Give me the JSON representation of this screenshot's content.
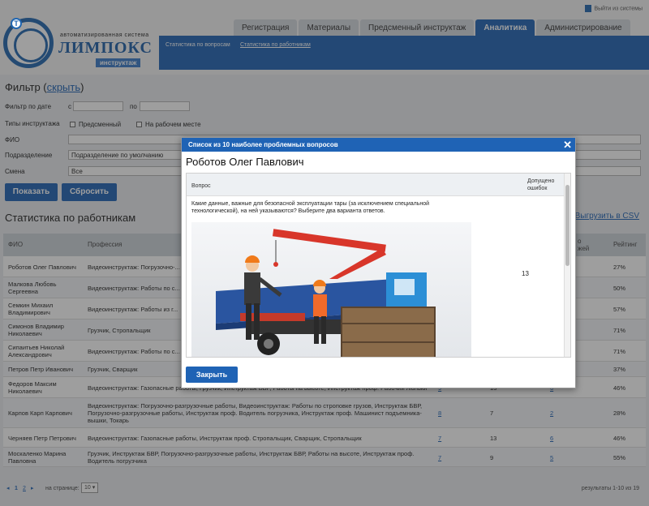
{
  "header": {
    "logo_subtitle": "автоматизированная система",
    "logo_name": "ЛИМПОКС",
    "logo_badge": "инструктаж",
    "logout": "Выйти из системы",
    "tabs": [
      "Регистрация",
      "Материалы",
      "Предсменный инструктаж",
      "Аналитика",
      "Администрирование"
    ],
    "active_tab": "Аналитика",
    "subnav": [
      "Статистика по вопросам",
      "Статистика по работникам"
    ]
  },
  "filter": {
    "title": "Фильтр (",
    "toggle": "скрыть",
    "title_end": ")",
    "date_label": "Фильтр по дате",
    "date_from": "с",
    "date_to": "по",
    "types_label": "Типы инструктажа",
    "type1": "Предсменный",
    "type2": "На рабочем месте",
    "fio_label": "ФИО",
    "dept_label": "Подразделение",
    "dept_value": "Подразделение по умолчанию",
    "shift_label": "Смена",
    "shift_value": "Все",
    "show_button": "Показать",
    "reset_button": "Сбросить"
  },
  "stats": {
    "title": "Статистика по работникам",
    "export": "Выгрузить в CSV",
    "col_fio": "ФИО",
    "col_prof": "Профессия",
    "col_errors_tail": "о",
    "col_errors_tail2": "жей",
    "col_rating": "Рейтинг",
    "rows": [
      {
        "fio": "Роботов Олег Павлович",
        "prof": "Видеоинструктаж: Погрузочно-... электропередачи, Инструктаж...",
        "a": "",
        "b": "",
        "c": "",
        "rating": "27%"
      },
      {
        "fio": "Малкова Любовь Сергеевна",
        "prof": "Видеоинструктаж: Работы по с... Стропальщик, Сварщик, Строп...",
        "a": "",
        "b": "",
        "c": "",
        "rating": "50%"
      },
      {
        "fio": "Семкин Михаил Владимирович",
        "prof": "Видеоинструктаж: Работы из г...",
        "a": "",
        "b": "",
        "c": "",
        "rating": "57%"
      },
      {
        "fio": "Симонов Владимир Николаевич",
        "prof": "Грузчик, Стропальщик",
        "a": "",
        "b": "",
        "c": "",
        "rating": "71%"
      },
      {
        "fio": "Сипаитьев Николай Александрович",
        "prof": "Видеоинструктаж: Работы по с... проф. Стропальщик, Грузчик",
        "a": "",
        "b": "",
        "c": "",
        "rating": "71%"
      },
      {
        "fio": "Петров Петр Иванович",
        "prof": "Грузчик, Сварщик",
        "a": "",
        "b": "",
        "c": "",
        "rating": "37%"
      },
      {
        "fio": "Федоров Максим Николаевич",
        "prof": "Видеоинструктаж: Газопасные работы, Грузчик, Инструктаж БВР, Работы на высоте, Инструктаж проф. Рабочий люльки",
        "a": "9",
        "b": "13",
        "c": "6",
        "rating": "46%"
      },
      {
        "fio": "Карпов Карп Карпович",
        "prof": "Видеоинструктаж: Погрузочно-разгрузочные работы, Видеоинструктаж: Работы по строповке грузов, Инструктаж БВР, Погрузочно-разгрузочные работы, Инструктаж проф. Водитель погрузчика, Инструктаж проф. Машинист подъемника-вышки, Токарь",
        "a": "8",
        "b": "7",
        "c": "2",
        "rating": "28%"
      },
      {
        "fio": "Черняев Петр Петрович",
        "prof": "Видеоинструктаж: Газопасные работы, Инструктаж проф. Стропальщик, Сварщик, Стропальщик",
        "a": "7",
        "b": "13",
        "c": "6",
        "rating": "46%"
      },
      {
        "fio": "Москаленко Марина Павловна",
        "prof": "Грузчик, Инструктаж БВР, Погрузочно-разгрузочные работы, Инструктаж БВР, Работы на высоте, Инструктаж проф. Водитель погрузчика",
        "a": "7",
        "b": "9",
        "c": "5",
        "rating": "55%"
      }
    ]
  },
  "pager": {
    "pages": [
      "1",
      "2"
    ],
    "per_page_label": "на странице:",
    "per_page_value": "10",
    "results": "результаты 1-10 из 19"
  },
  "modal": {
    "title": "Список из 10 наиболее проблемных вопросов",
    "person": "Роботов Олег Павлович",
    "col_question": "Вопрос",
    "col_errors": "Допущено ошибок",
    "question_text": "Какие данные, важные для безопасной эксплуатации тары (за исключением специальной технологической), на ней указываются? Выберите два варианта ответов.",
    "errors_value": "13",
    "close_button": "Закрыть"
  }
}
